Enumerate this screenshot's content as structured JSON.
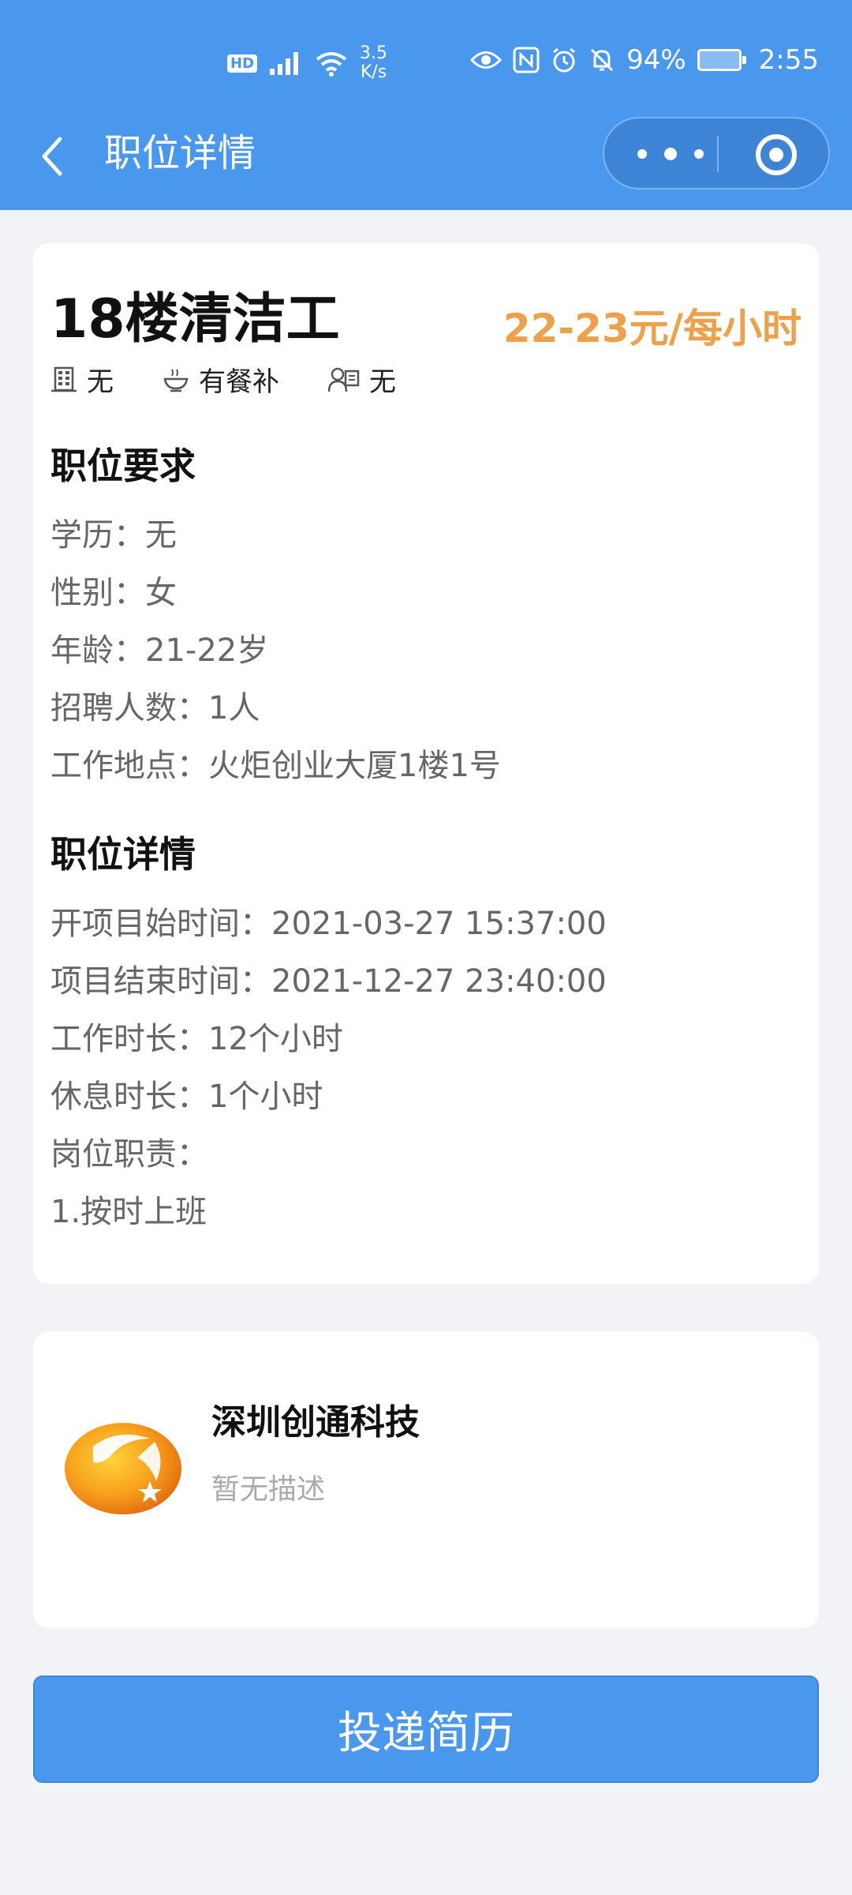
{
  "status_bar": {
    "hd": "HD",
    "net_speed_value": "3.5",
    "net_speed_unit": "K/s",
    "battery": "94%",
    "time": "2:55"
  },
  "nav": {
    "title": "职位详情"
  },
  "job": {
    "title": "18楼清洁工",
    "salary": "22-23元/每小时",
    "tags": [
      {
        "icon": "building-icon",
        "label": "无"
      },
      {
        "icon": "bowl-icon",
        "label": "有餐补"
      },
      {
        "icon": "insurance-icon",
        "label": "无"
      }
    ],
    "requirements_title": "职位要求",
    "requirements": [
      "学历：无",
      "性别：女",
      "年龄：21-22岁",
      "招聘人数：1人",
      "工作地点：火炬创业大厦1楼1号"
    ],
    "details_title": "职位详情",
    "details": [
      "开项目始时间：2021-03-27 15:37:00",
      "项目结束时间：2021-12-27 23:40:00",
      "工作时长：12个小时",
      "休息时长：1个小时",
      "岗位职责：",
      "1.按时上班"
    ]
  },
  "company": {
    "name": "深圳创通科技",
    "description": "暂无描述"
  },
  "actions": {
    "submit_label": "投递简历"
  },
  "colors": {
    "primary": "#4a98ee",
    "salary": "#efa04b",
    "background": "#f1f3f6"
  }
}
